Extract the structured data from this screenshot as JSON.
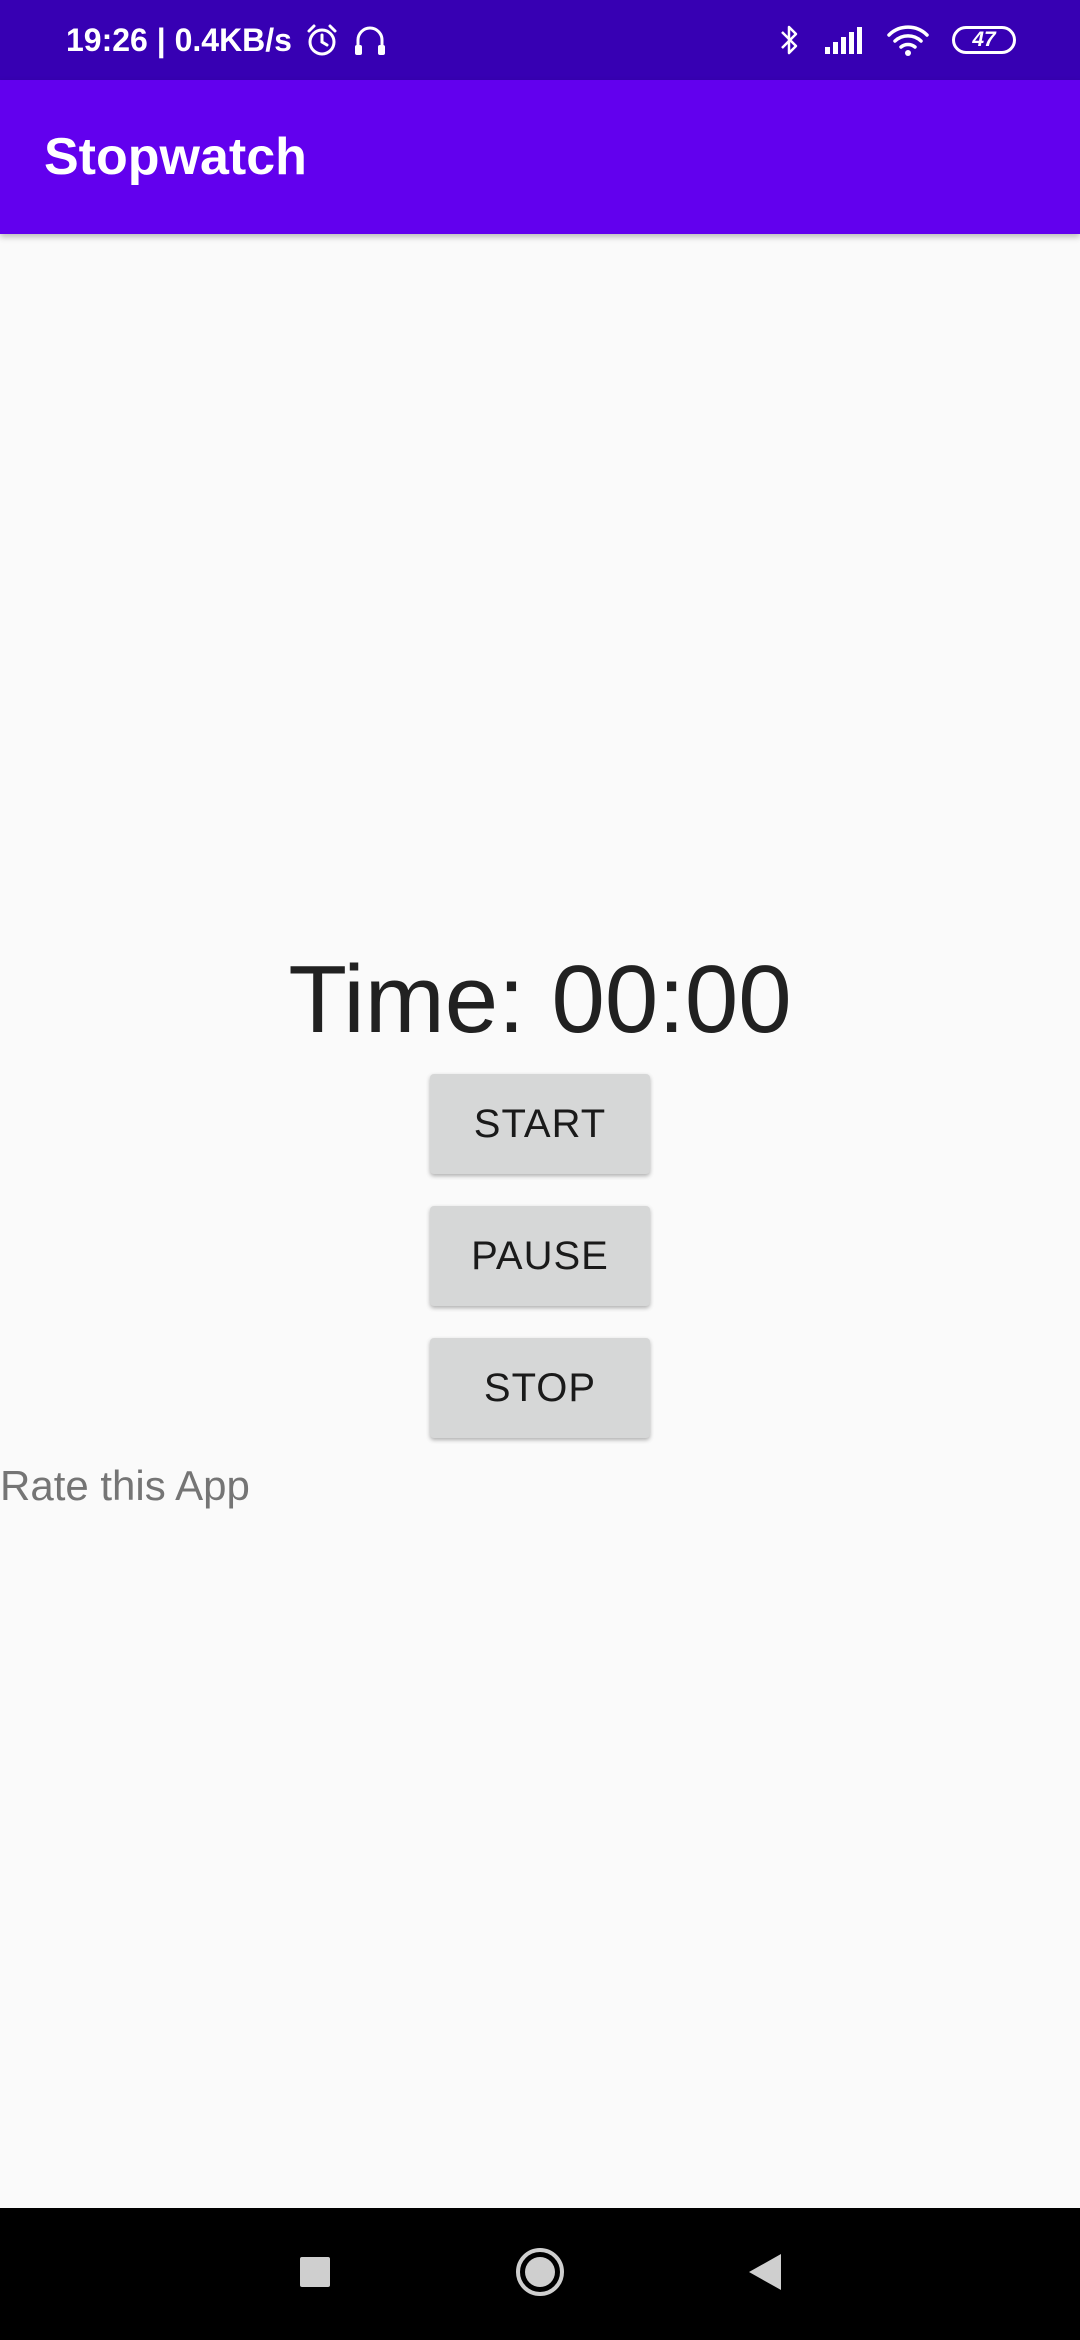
{
  "status_bar": {
    "time_speed": "19:26 | 0.4KB/s",
    "icons": [
      "alarm-icon",
      "headphones-icon",
      "bluetooth-icon",
      "signal-icon",
      "wifi-icon"
    ],
    "battery_level": "47"
  },
  "app_bar": {
    "title": "Stopwatch"
  },
  "main": {
    "time_label": "Time: 00:00",
    "start_label": "START",
    "pause_label": "PAUSE",
    "stop_label": "STOP",
    "rate_label": "Rate this App"
  },
  "nav_bar": {
    "icons": [
      "recents-icon",
      "home-icon",
      "back-icon"
    ]
  },
  "colors": {
    "status_bar": "#3700b3",
    "app_bar": "#6200ee",
    "background": "#fafafa",
    "button": "#d6d7d7"
  }
}
